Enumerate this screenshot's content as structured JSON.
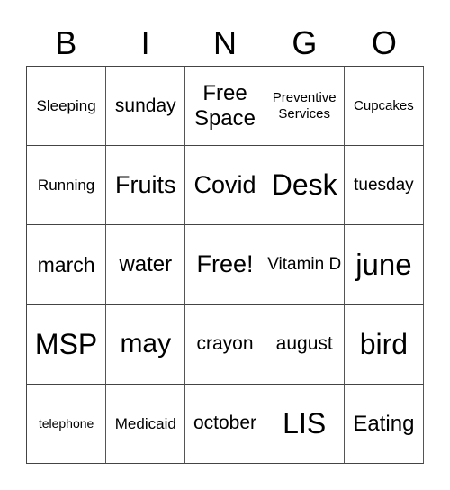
{
  "header": [
    "B",
    "I",
    "N",
    "G",
    "O"
  ],
  "rows": [
    [
      "Sleeping",
      "sunday",
      "Free Space",
      "Preventive Services",
      "Cupcakes"
    ],
    [
      "Running",
      "Fruits",
      "Covid",
      "Desk",
      "tuesday"
    ],
    [
      "march",
      "water",
      "Free!",
      "Vitamin D",
      "june"
    ],
    [
      "MSP",
      "may",
      "crayon",
      "august",
      "bird"
    ],
    [
      "telephone",
      "Medicaid",
      "october",
      "LIS",
      "Eating"
    ]
  ]
}
